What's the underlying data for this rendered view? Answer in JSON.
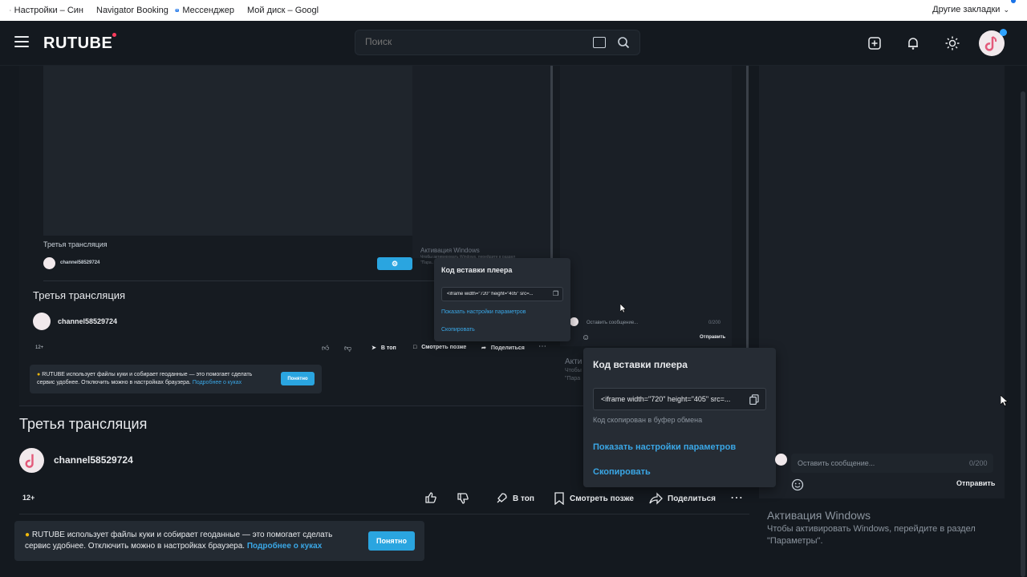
{
  "bookmarks": [
    {
      "label": "Настройки – Син",
      "icon": "gear-icon"
    },
    {
      "label": "Navigator Booking",
      "icon": "navigator-icon"
    },
    {
      "label": "Мессенджер",
      "icon": "messenger-icon"
    },
    {
      "label": "Мой диск – Googl",
      "icon": "google-drive-icon"
    }
  ],
  "bookmarks_other": "Другие закладки",
  "header": {
    "logo": "RUTUBE",
    "search_placeholder": "Поиск"
  },
  "colors": {
    "accent": "#2aa5e0",
    "link": "#3aa7e6",
    "background": "#14191f",
    "logo_dot": "#ff3b5c"
  },
  "nested3": {
    "title": "Третья трансляция",
    "channel": "channel58529724",
    "windows_title": "Активация Windows",
    "windows_sub": "Чтобы активировать Windows, перейдите в раздел",
    "windows_sub2": "\"Пара...\""
  },
  "nested2": {
    "title": "Третья трансляция",
    "channel": "channel58529724",
    "age": "12+",
    "actions": {
      "top": "В топ",
      "later": "Смотреть позже",
      "share": "Поделиться"
    },
    "cookie_text_1": "RUTUBE использует файлы куки и собирает геоданные — это помогает сделать",
    "cookie_text_2": "сервис удобнее. Отключить можно в настройках браузера.",
    "cookie_link": "Подробнее о куках",
    "cookie_button": "Понятно",
    "chat_placeholder": "Оставить сообщение...",
    "chat_counter": "0/200",
    "chat_send": "Отправить",
    "windows_title": "Акти",
    "windows_sub": "Чтобы",
    "windows_sub2": "\"Пара"
  },
  "embed_small": {
    "title": "Код вставки плеера",
    "code": "<iframe width=\"720\" height=\"405\" src=...",
    "show_params": "Показать настройки параметров",
    "copy": "Скопировать"
  },
  "embed_main": {
    "title": "Код вставки плеера",
    "code": "<iframe width=\"720\" height=\"405\" src=...",
    "copied_notice": "Код скопирован в буфер обмена",
    "show_params": "Показать настройки параметров",
    "copy": "Скопировать"
  },
  "video": {
    "title": "Третья трансляция",
    "channel": "channel58529724",
    "age": "12+",
    "actions": {
      "top": "В топ",
      "later": "Смотреть позже",
      "share": "Поделиться"
    }
  },
  "cookie": {
    "text_1": "RUTUBE использует файлы куки и собирает геоданные — это помогает сделать",
    "text_2": "сервис удобнее. Отключить можно в настройках браузера.",
    "link": "Подробнее о куках",
    "button": "Понятно"
  },
  "chat": {
    "placeholder": "Оставить сообщение...",
    "counter": "0/200",
    "send": "Отправить"
  },
  "windows": {
    "title": "Активация Windows",
    "line1": "Чтобы активировать Windows, перейдите в раздел",
    "line2": "\"Параметры\"."
  }
}
